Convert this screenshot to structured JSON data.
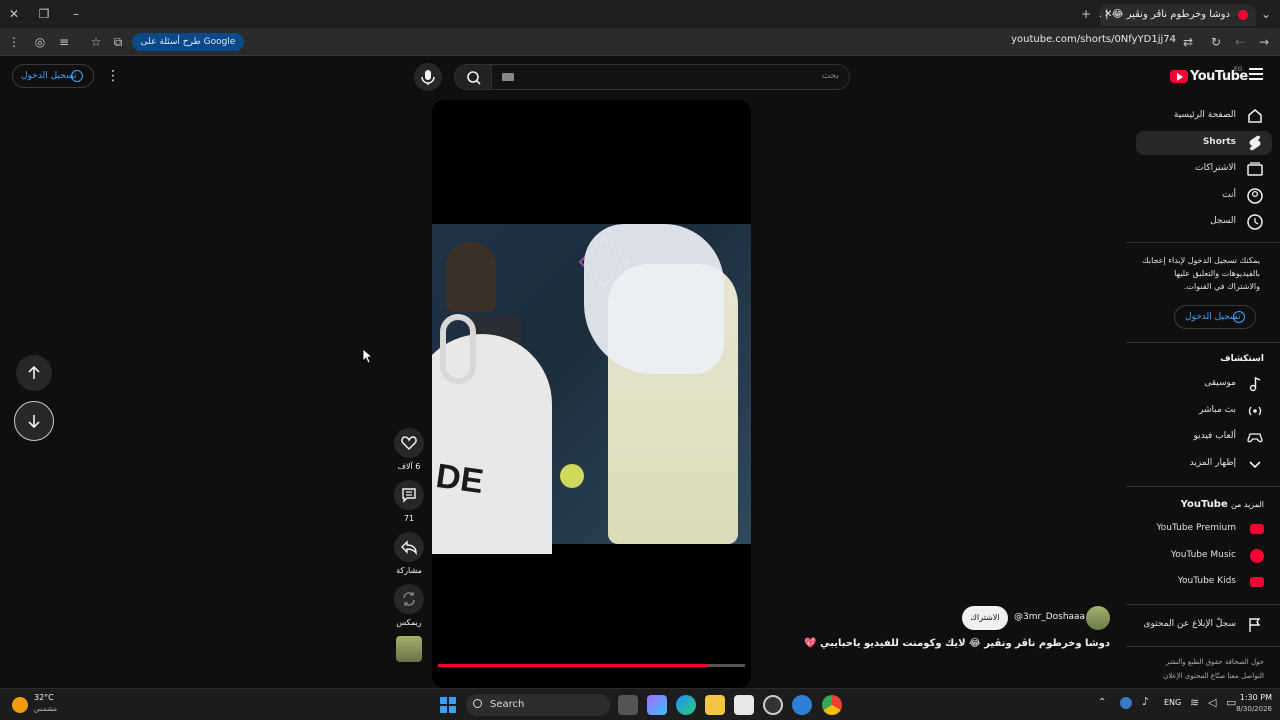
{
  "browser": {
    "tab_title": "دوشا وخرطوم ناڤر ونڤير 😂 | ...",
    "url": "youtube.com/shorts/0NfyYD1jj74",
    "google_chip": "طرح أسئلة على Google"
  },
  "header": {
    "sign_in": "تسجيل الدخول",
    "search_placeholder": "بحث",
    "logo": "YouTube",
    "logo_region": "EG"
  },
  "sidebar": {
    "items": [
      {
        "label": "الصفحة الرئيسية",
        "icon": "home-icon"
      },
      {
        "label": "Shorts",
        "icon": "shorts-icon"
      },
      {
        "label": "الاشتراكات",
        "icon": "subscriptions-icon"
      },
      {
        "label": "أنت",
        "icon": "user-icon"
      },
      {
        "label": "السجل",
        "icon": "history-icon"
      }
    ],
    "signin_prompt": "يمكنك تسجيل الدخول لإبداء إعجابك بالفيديوهات والتعليق عليها والاشتراك في القنوات.",
    "signin_button": "تسجيل الدخول",
    "explore_title": "استكشاف",
    "explore": [
      {
        "label": "موسيقى",
        "icon": "music-icon"
      },
      {
        "label": "بث مباشر",
        "icon": "live-icon"
      },
      {
        "label": "ألعاب فيديو",
        "icon": "gaming-icon"
      },
      {
        "label": "إظهار المزيد",
        "icon": "chevron-down-icon"
      }
    ],
    "more_title_prefix": "المزيد من",
    "more_title_brand": "YouTube",
    "more": [
      {
        "label": "YouTube Premium"
      },
      {
        "label": "YouTube Music"
      },
      {
        "label": "YouTube Kids"
      }
    ],
    "report": "سجلّ الإبلاغ عن المحتوى",
    "footer_line1": "حول  الصحافة  حقوق الطبع والنشر",
    "footer_line2": "التواصل معنا  صنّاع المحتوى  الإعلان"
  },
  "short": {
    "channel": "@3mr_Doshaaa",
    "subscribe": "الاشتراك",
    "title": "دوشا وخرطوم ناڤر ونڤير 😂  لايك وكومنت للفيديو ياحبايبي 💖",
    "likes": "6 آلاف",
    "comments": "71",
    "share": "مشاركة",
    "remix": "ريمكس",
    "progress": 0.88,
    "shirt_text": "DE"
  },
  "taskbar": {
    "weather_temp": "32°C",
    "weather_desc": "مشمس",
    "search": "Search",
    "lang": "ENG",
    "time": "1:30 PM",
    "date": "8/30/2026"
  },
  "colors": {
    "brand_red": "#ff0033",
    "link_blue": "#3ea6ff"
  }
}
